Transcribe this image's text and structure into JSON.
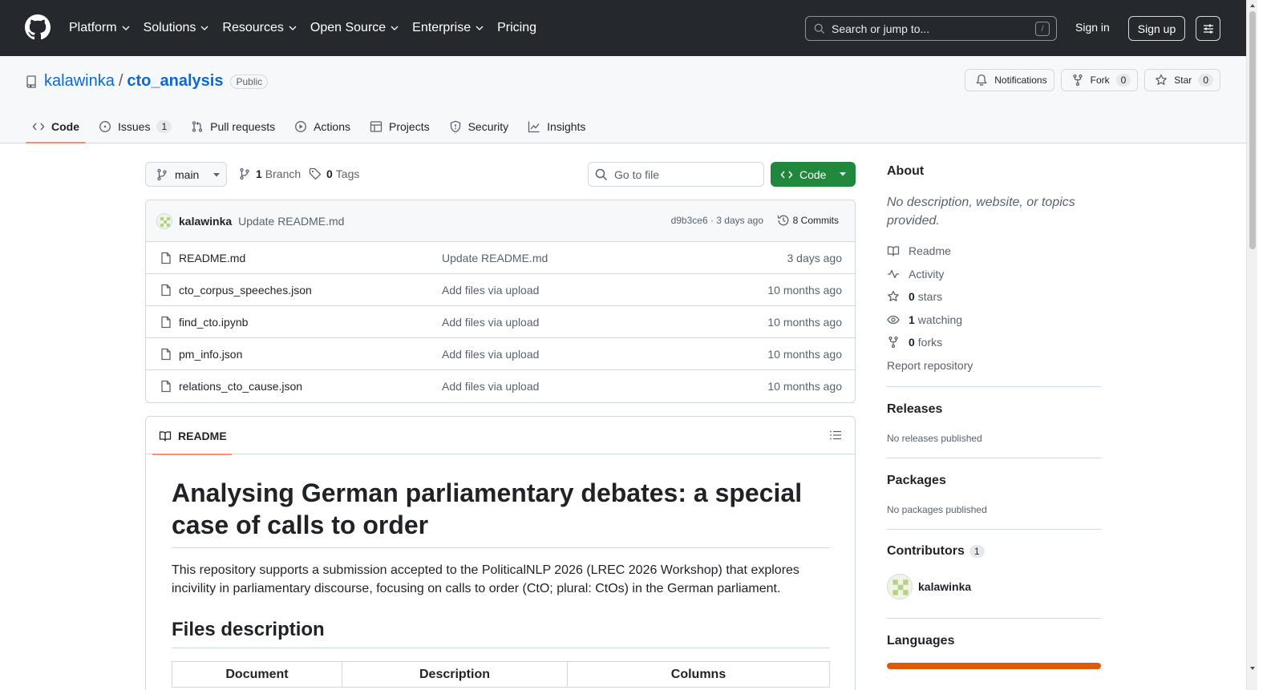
{
  "header": {
    "nav": [
      {
        "label": "Platform",
        "has_menu": true
      },
      {
        "label": "Solutions",
        "has_menu": true
      },
      {
        "label": "Resources",
        "has_menu": true
      },
      {
        "label": "Open Source",
        "has_menu": true
      },
      {
        "label": "Enterprise",
        "has_menu": true
      },
      {
        "label": "Pricing",
        "has_menu": false
      }
    ],
    "search_placeholder": "Search or jump to...",
    "search_shortcut": "/",
    "signin_label": "Sign in",
    "signup_label": "Sign up"
  },
  "repo": {
    "owner": "kalawinka",
    "separator": "/",
    "name": "cto_analysis",
    "visibility": "Public",
    "notifications_label": "Notifications",
    "fork_label": "Fork",
    "fork_count": "0",
    "star_label": "Star",
    "star_count": "0"
  },
  "tabs": [
    {
      "label": "Code",
      "active": true,
      "icon": "code-icon"
    },
    {
      "label": "Issues",
      "count": "1",
      "icon": "issue-icon"
    },
    {
      "label": "Pull requests",
      "icon": "pull-request-icon"
    },
    {
      "label": "Actions",
      "icon": "play-icon"
    },
    {
      "label": "Projects",
      "icon": "table-icon"
    },
    {
      "label": "Security",
      "icon": "shield-icon"
    },
    {
      "label": "Insights",
      "icon": "graph-icon"
    }
  ],
  "toolbar": {
    "branch": "main",
    "branch_count": "1",
    "branch_label": "Branch",
    "tag_count": "0",
    "tag_label": "Tags",
    "goto_placeholder": "Go to file",
    "code_label": "Code"
  },
  "latest_commit": {
    "author": "kalawinka",
    "message": "Update README.md",
    "sha_time": "d9b3ce6 · 3 days ago",
    "commits_label": "8 Commits"
  },
  "files": [
    {
      "name": "README.md",
      "message": "Update README.md",
      "date": "3 days ago"
    },
    {
      "name": "cto_corpus_speeches.json",
      "message": "Add files via upload",
      "date": "10 months ago"
    },
    {
      "name": "find_cto.ipynb",
      "message": "Add files via upload",
      "date": "10 months ago"
    },
    {
      "name": "pm_info.json",
      "message": "Add files via upload",
      "date": "10 months ago"
    },
    {
      "name": "relations_cto_cause.json",
      "message": "Add files via upload",
      "date": "10 months ago"
    }
  ],
  "readme": {
    "tab_label": "README",
    "title": "Analysing German parliamentary debates: a special case of calls to order",
    "intro": "This repository supports a submission accepted to the PoliticalNLP 2026 (LREC 2026 Workshop) that explores incivility in parliamentary discourse, focusing on calls to order (CtO; plural: CtOs) in the German parliament.",
    "section_title": "Files description",
    "table_headers": [
      "Document",
      "Description",
      "Columns"
    ]
  },
  "sidebar": {
    "about_title": "About",
    "about_desc": "No description, website, or topics provided.",
    "links": [
      {
        "icon": "book-icon",
        "label": "Readme"
      },
      {
        "icon": "pulse-icon",
        "label": "Activity"
      },
      {
        "icon": "star-icon",
        "count": "0",
        "label": "stars"
      },
      {
        "icon": "eye-icon",
        "count": "1",
        "label": "watching"
      },
      {
        "icon": "fork-icon",
        "count": "0",
        "label": "forks"
      }
    ],
    "report_label": "Report repository",
    "releases_title": "Releases",
    "releases_text": "No releases published",
    "packages_title": "Packages",
    "packages_text": "No packages published",
    "contributors_title": "Contributors",
    "contributors_count": "1",
    "contributor_name": "kalawinka",
    "languages_title": "Languages",
    "language_color": "#DA5B0B"
  },
  "colors": {
    "header_bg": "#25292e",
    "link": "#0969da",
    "primary_button": "#1f883d",
    "active_tab_underline": "#fd8c73"
  }
}
